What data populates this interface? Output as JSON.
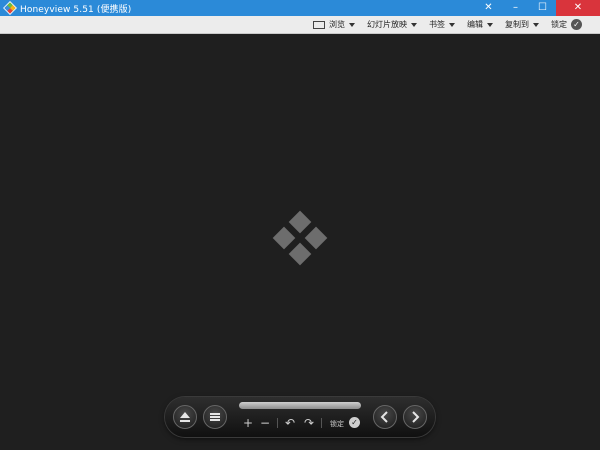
{
  "window": {
    "title": "Honeyview 5.51 (便携版)",
    "controls": {
      "close": "✕",
      "minimize": "–",
      "maximize": "☐"
    },
    "title_color": "#2b8ad8",
    "close_color": "#d9343c"
  },
  "menubar": {
    "items": [
      {
        "label": "浏览",
        "icon": "screen-icon"
      },
      {
        "label": "幻灯片放映"
      },
      {
        "label": "书签"
      },
      {
        "label": "编辑"
      },
      {
        "label": "复制到"
      },
      {
        "label": "锁定",
        "icon": "check-circle-icon"
      }
    ]
  },
  "canvas": {
    "background": "#1f1f1f",
    "logo": "honeyview-diamond-logo"
  },
  "controlbar": {
    "lock_label": "锁定",
    "buttons": [
      "eject-icon",
      "menu-icon",
      "zoom-in-icon",
      "zoom-out-icon",
      "rotate-left-icon",
      "rotate-right-icon",
      "check-circle-icon",
      "prev-icon",
      "next-icon"
    ]
  }
}
